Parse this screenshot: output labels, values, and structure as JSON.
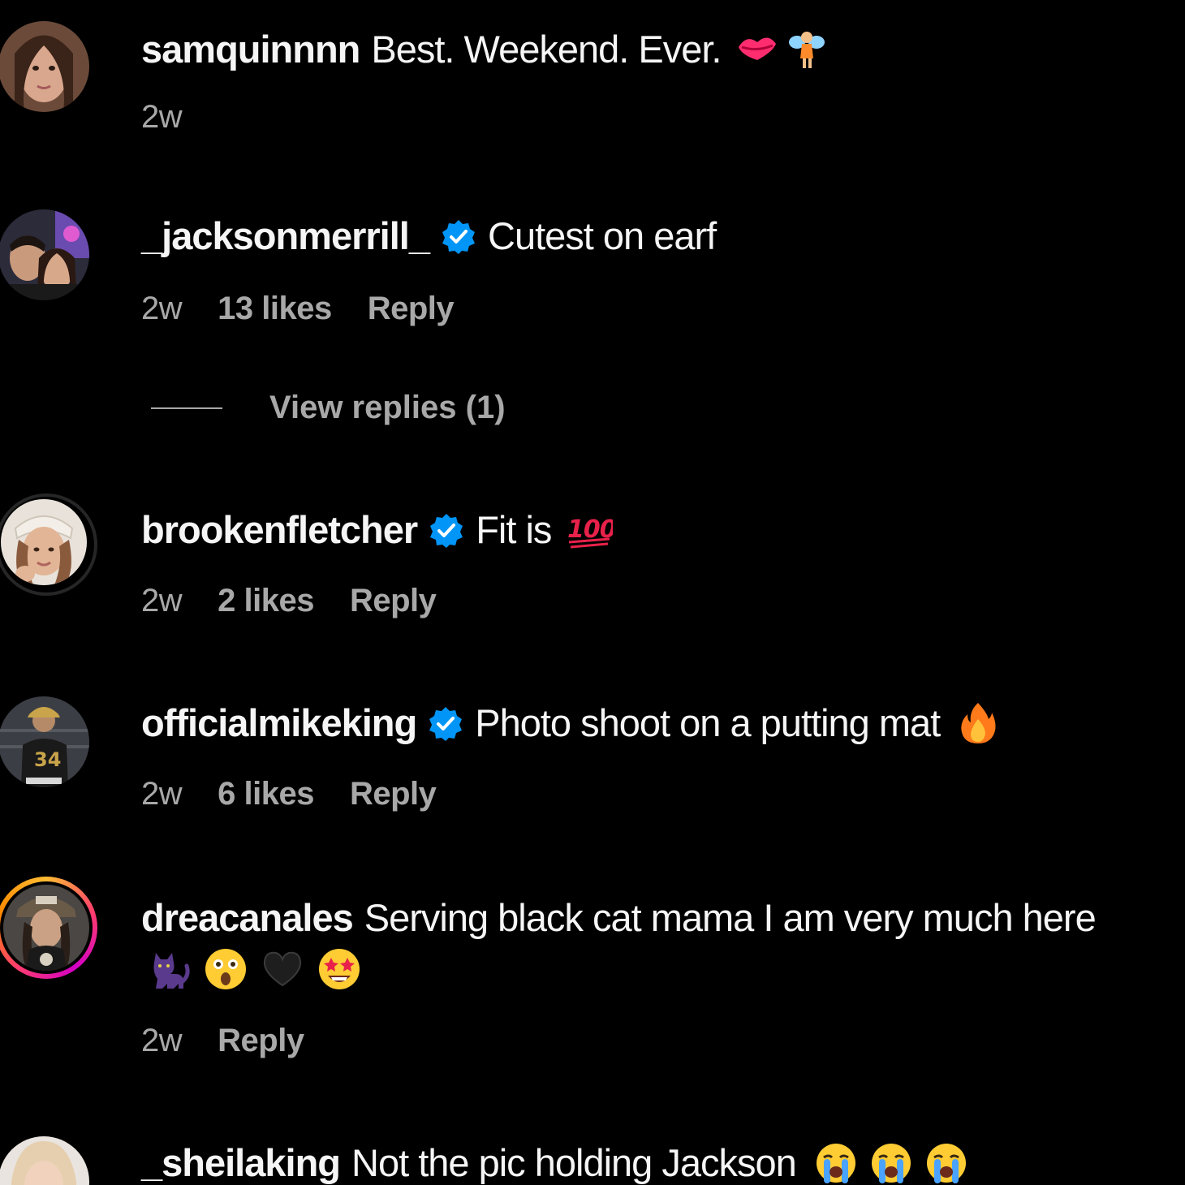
{
  "comments": [
    {
      "username": "samquinnnn",
      "verified": false,
      "text": "Best. Weekend. Ever.",
      "emojis": [
        "kiss-mark",
        "fairy"
      ],
      "time": "2w",
      "likes": "",
      "reply": ""
    },
    {
      "username": "_jacksonmerrill_",
      "verified": true,
      "text": "Cutest on earf",
      "emojis": [],
      "time": "2w",
      "likes": "13 likes",
      "reply": "Reply",
      "view_replies": "View replies (1)"
    },
    {
      "username": "brookenfletcher",
      "verified": true,
      "text": "Fit is",
      "emojis": [
        "hundred-points"
      ],
      "time": "2w",
      "likes": "2 likes",
      "reply": "Reply"
    },
    {
      "username": "officialmikeking",
      "verified": true,
      "text": "Photo shoot on a putting mat",
      "emojis": [
        "fire"
      ],
      "time": "2w",
      "likes": "6 likes",
      "reply": "Reply"
    },
    {
      "username": "dreacanales",
      "verified": false,
      "text": "Serving black cat mama I am very much here",
      "emojis": [
        "black-cat",
        "astonished-face",
        "black-heart",
        "star-struck"
      ],
      "time": "2w",
      "likes": "",
      "reply": "Reply"
    },
    {
      "username": "_sheilaking",
      "verified": false,
      "text": "Not the pic holding Jackson",
      "emojis": [
        "loudly-crying-face",
        "loudly-crying-face",
        "loudly-crying-face"
      ],
      "time": "",
      "likes": "",
      "reply": ""
    }
  ],
  "colors": {
    "background": "#000000",
    "text": "#f5f5f5",
    "muted": "#a8a8a8",
    "verified": "#0095f6"
  }
}
